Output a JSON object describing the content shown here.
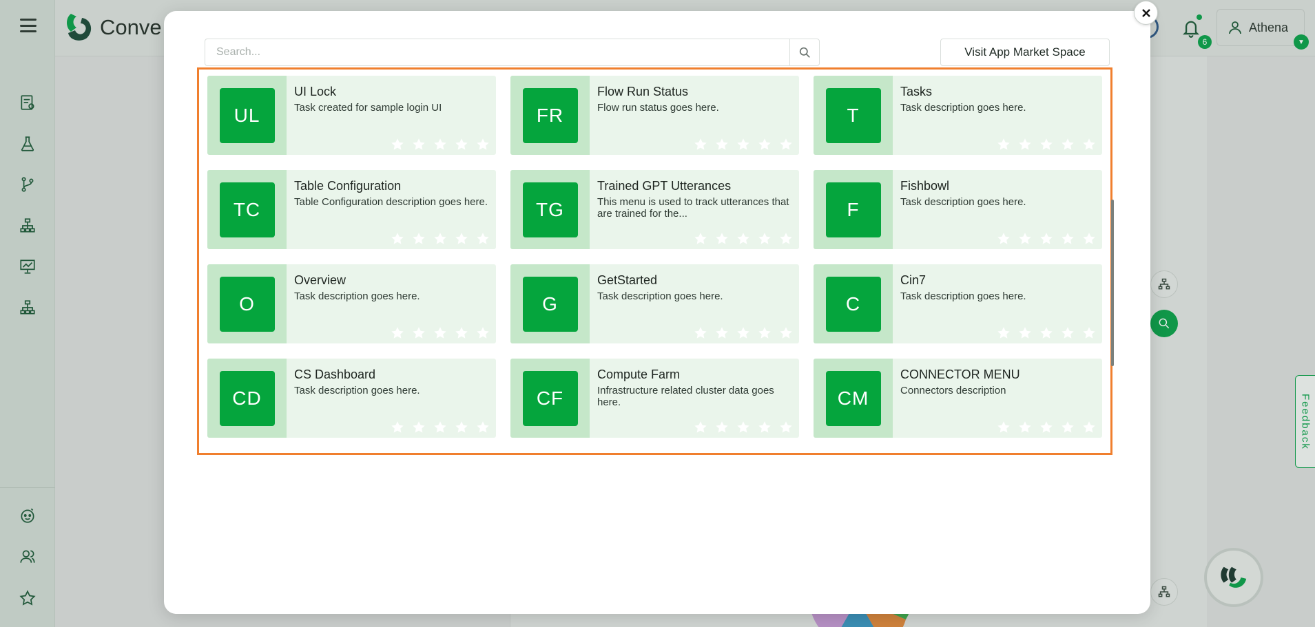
{
  "app": {
    "brand_text": "Conve",
    "user_name": "Athena",
    "notification_count": "6",
    "feedback_label": "Feedback"
  },
  "sidebar_icons": [
    "task-list-icon",
    "flask-icon",
    "branch-icon",
    "hierarchy-icon",
    "presentation-chart-icon",
    "org-chart-icon",
    "bot-face-icon",
    "users-icon",
    "star-icon"
  ],
  "modal": {
    "search_placeholder": "Search...",
    "market_button_label": "Visit App Market Space",
    "cards": [
      {
        "initials": "UL",
        "title": "UI Lock",
        "desc": "Task created for sample login UI"
      },
      {
        "initials": "FR",
        "title": "Flow Run Status",
        "desc": "Flow run status goes here."
      },
      {
        "initials": "T",
        "title": "Tasks",
        "desc": "Task description goes here."
      },
      {
        "initials": "TC",
        "title": "Table Configuration",
        "desc": "Table Configuration description goes here."
      },
      {
        "initials": "TG",
        "title": "Trained GPT Utterances",
        "desc": "This menu is used to track utterances that are trained for the..."
      },
      {
        "initials": "F",
        "title": "Fishbowl",
        "desc": "Task description goes here."
      },
      {
        "initials": "O",
        "title": "Overview",
        "desc": "Task description goes here."
      },
      {
        "initials": "G",
        "title": "GetStarted",
        "desc": "Task description goes here."
      },
      {
        "initials": "C",
        "title": "Cin7",
        "desc": "Task description goes here."
      },
      {
        "initials": "CD",
        "title": "CS Dashboard",
        "desc": "Task description goes here."
      },
      {
        "initials": "CF",
        "title": "Compute Farm",
        "desc": "Infrastructure related cluster data goes here."
      },
      {
        "initials": "CM",
        "title": "CONNECTOR MENU",
        "desc": "Connectors description"
      }
    ],
    "rating_stars": 5
  },
  "colors": {
    "brand_green": "#0ba24a",
    "avatar_green": "#05a53d",
    "highlight_orange": "#f07f2e",
    "card_bg": "#eaf5eb",
    "card_side_bg": "#c5e7c9"
  }
}
